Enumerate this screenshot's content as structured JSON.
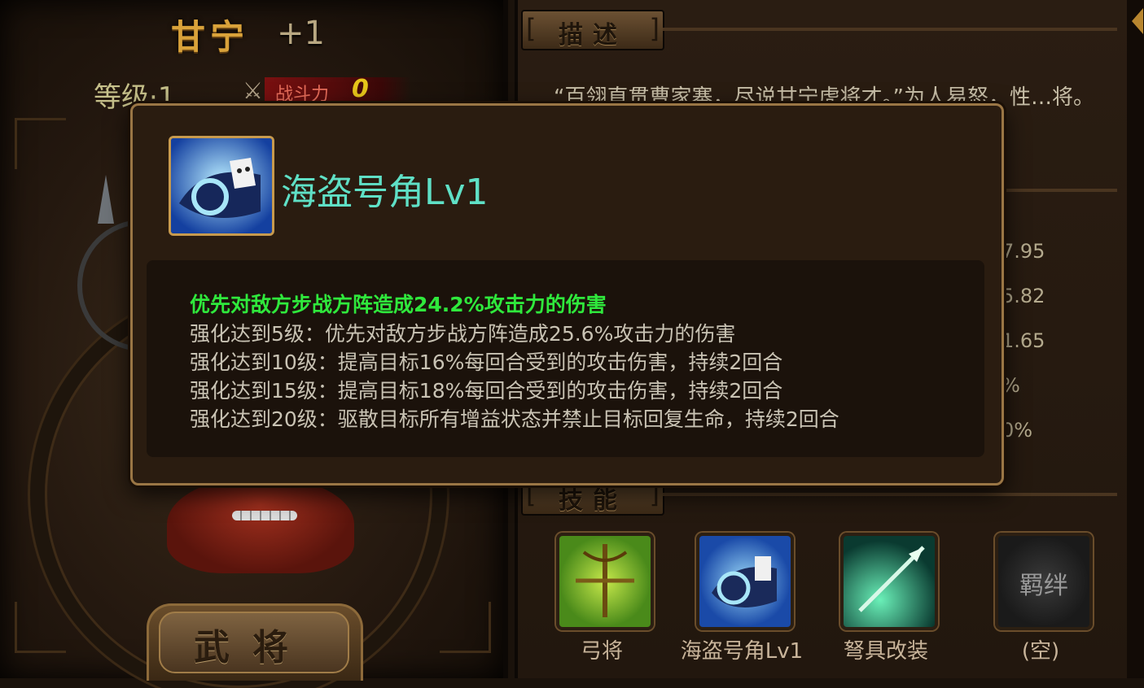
{
  "hero": {
    "name": "甘宁",
    "plus": "+1",
    "level": "等级·1",
    "power_label": "战斗力",
    "power_value": "0"
  },
  "left_tab": {
    "label": "武将"
  },
  "description": {
    "header": "描述",
    "text": "“百翎直贯曹家寨，尽说甘宁虎将才。”为人易怒，性…将。"
  },
  "stats": [
    "7.95",
    "5.82",
    "1.65",
    "%",
    "0%"
  ],
  "skills_section": {
    "header": "技能",
    "slots": [
      {
        "label": "弓将",
        "icon": "bow-general-icon"
      },
      {
        "label": "海盗号角Lv1",
        "icon": "pirate-horn-icon"
      },
      {
        "label": "弩具改装",
        "icon": "crossbow-mod-icon"
      },
      {
        "label": "(空)",
        "icon": "bond-icon",
        "inner_text": "羁绊"
      }
    ]
  },
  "popup": {
    "icon": "pirate-horn-icon",
    "title": "海盗号角Lv1",
    "main_effect": "优先对敌方步战方阵造成24.2%攻击力的伤害",
    "upgrades": [
      "强化达到5级：优先对敌方步战方阵造成25.6%攻击力的伤害",
      "强化达到10级：提高目标16%每回合受到的攻击伤害，持续2回合",
      "强化达到15级：提高目标18%每回合受到的攻击伤害，持续2回合",
      "强化达到20级：驱散目标所有增益状态并禁止目标回复生命，持续2回合"
    ]
  },
  "colors": {
    "title_teal": "#5fe0c6",
    "effect_green": "#2fe83c",
    "gold": "#d9a23a",
    "panel_border": "#9a7645"
  }
}
